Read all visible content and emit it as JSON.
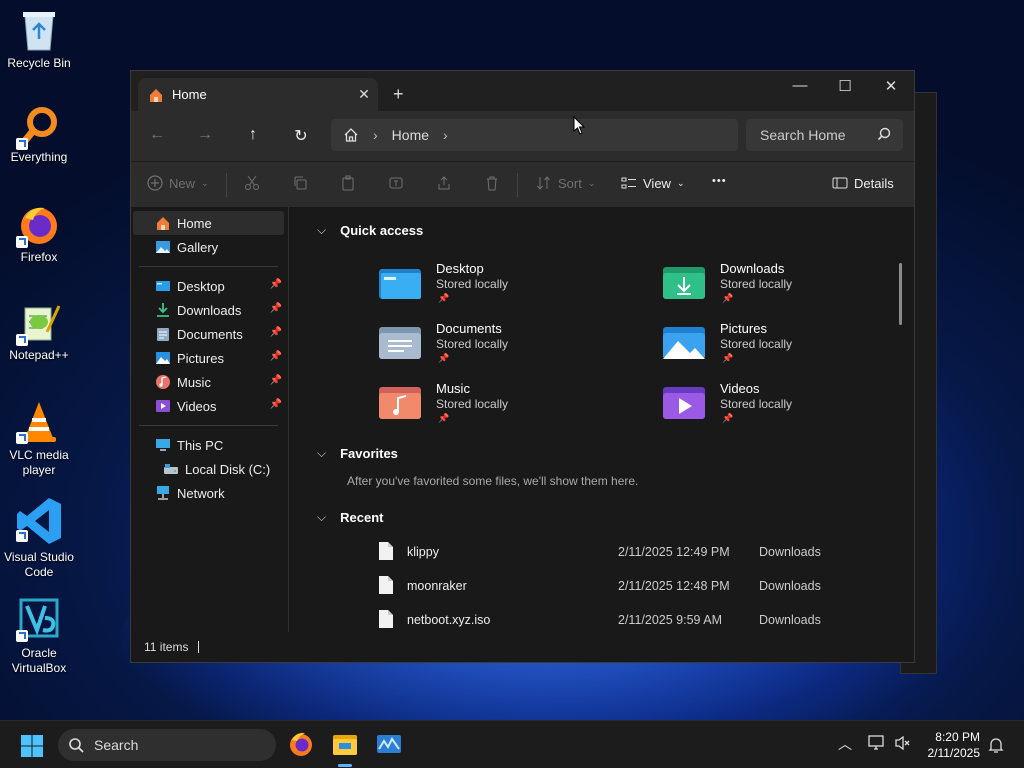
{
  "desktop": {
    "icons": [
      {
        "label": "Recycle Bin"
      },
      {
        "label": "Everything"
      },
      {
        "label": "Firefox"
      },
      {
        "label": "Notepad++"
      },
      {
        "label": "VLC media player"
      },
      {
        "label": "Visual Studio Code"
      },
      {
        "label": "Oracle VirtualBox"
      }
    ]
  },
  "window": {
    "tab": {
      "title": "Home",
      "close": "✕"
    },
    "new_tab": "+",
    "controls": {
      "minimize": "—",
      "maximize": "☐",
      "close": "✕"
    },
    "nav": {
      "back": "←",
      "forward": "→",
      "up": "↑",
      "refresh": "↻"
    },
    "address": {
      "crumb": "Home",
      "chevron": "›"
    },
    "search": {
      "placeholder": "Search Home"
    },
    "toolbar": {
      "new": "New",
      "sort": "Sort",
      "view": "View",
      "more": "•••",
      "details": "Details"
    },
    "sidebar": {
      "top": [
        {
          "label": "Home"
        },
        {
          "label": "Gallery"
        }
      ],
      "pinned": [
        {
          "label": "Desktop"
        },
        {
          "label": "Downloads"
        },
        {
          "label": "Documents"
        },
        {
          "label": "Pictures"
        },
        {
          "label": "Music"
        },
        {
          "label": "Videos"
        }
      ],
      "pc": [
        {
          "label": "This PC"
        },
        {
          "label": "Local Disk (C:)"
        },
        {
          "label": "Network"
        }
      ]
    },
    "sections": {
      "quick_access": "Quick access",
      "favorites": "Favorites",
      "recent": "Recent"
    },
    "quick_access": [
      {
        "name": "Desktop",
        "status": "Stored locally"
      },
      {
        "name": "Downloads",
        "status": "Stored locally"
      },
      {
        "name": "Documents",
        "status": "Stored locally"
      },
      {
        "name": "Pictures",
        "status": "Stored locally"
      },
      {
        "name": "Music",
        "status": "Stored locally"
      },
      {
        "name": "Videos",
        "status": "Stored locally"
      }
    ],
    "favorites_empty": "After you've favorited some files, we'll show them here.",
    "recent": [
      {
        "name": "klippy",
        "date": "2/11/2025 12:49 PM",
        "location": "Downloads"
      },
      {
        "name": "moonraker",
        "date": "2/11/2025 12:48 PM",
        "location": "Downloads"
      },
      {
        "name": "netboot.xyz.iso",
        "date": "2/11/2025 9:59 AM",
        "location": "Downloads"
      }
    ],
    "status": {
      "items": "11 items"
    }
  },
  "taskbar": {
    "search_placeholder": "Search",
    "clock": {
      "time": "8:20 PM",
      "date": "2/11/2025"
    }
  },
  "colors": {
    "accent": "#5fb2ff",
    "window_bg": "#191919",
    "toolbar_bg": "#2c2c2c"
  }
}
